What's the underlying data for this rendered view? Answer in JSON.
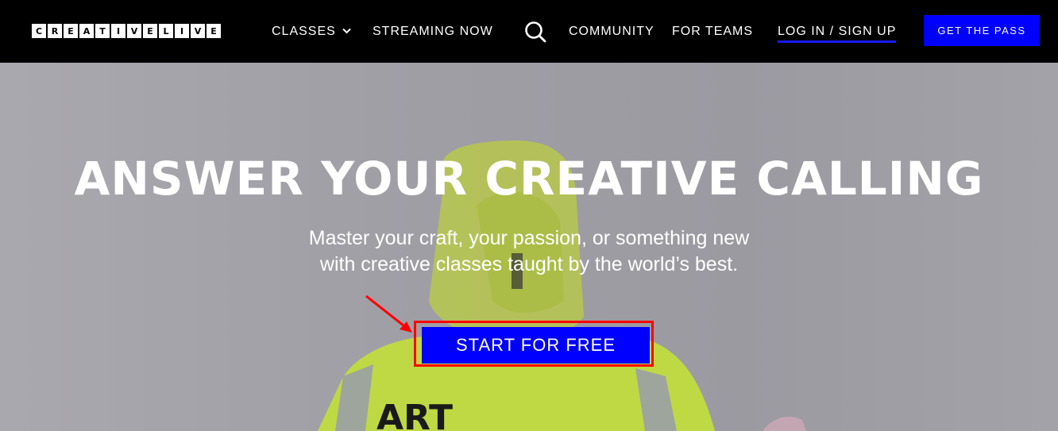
{
  "nav": {
    "logo_letters": [
      "C",
      "R",
      "E",
      "A",
      "T",
      "I",
      "V",
      "E",
      "L",
      "I",
      "V",
      "E"
    ],
    "classes_label": "CLASSES",
    "streaming_label": "STREAMING NOW",
    "community_label": "COMMUNITY",
    "teams_label": "FOR TEAMS",
    "login_label": "LOG IN / SIGN UP",
    "pass_label": "GET THE PASS"
  },
  "hero": {
    "title": "ANSWER YOUR CREATIVE CALLING",
    "subtitle_line1": "Master your craft, your passion, or something new",
    "subtitle_line2": "with creative classes taught by the world’s best.",
    "cta_label": "START FOR FREE",
    "jacket_text": "ART"
  },
  "colors": {
    "nav_bg": "#000000",
    "accent_blue": "#0000ff",
    "annotation_red": "#ff0000",
    "jacket_yellow": "#c8e03a"
  },
  "icons": {
    "classes_chevron": "chevron-down-icon",
    "search": "search-icon",
    "annotation": "arrow-annotation-icon"
  }
}
